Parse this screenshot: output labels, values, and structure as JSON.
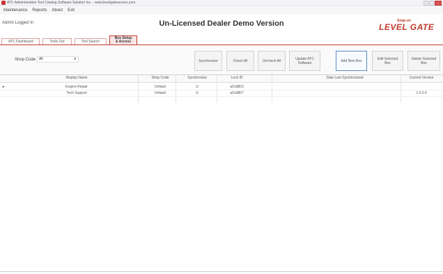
{
  "window": {
    "title": "ATC Administration Tool Catalog Software Solution Inc. - www.levelgateaccess.com"
  },
  "menu": [
    "Maintenance",
    "Reports",
    "About",
    "Exit"
  ],
  "header": {
    "login": "Admin Logged In",
    "title": "Un-Licensed Dealer Demo Version",
    "logo_tag": "Snap-on",
    "logo_mark": "LEVEL GATE"
  },
  "tabs": [
    "ATC Dashboard",
    "Tools Out",
    "Tool Search",
    "Box Setup & Access"
  ],
  "toolbar": {
    "shop_code_label": "Shop Code",
    "shop_code_value": "All",
    "synchronize": "Synchronize",
    "check_all": "Check All",
    "uncheck_all": "Uncheck All",
    "update_atc": "Update ATC Software",
    "add_new_box": "Add New Box",
    "edit_selected": "Edit Selected Box",
    "delete_selected": "Delete Selected Box"
  },
  "table": {
    "columns": [
      "Display Name",
      "Shop Code",
      "Synchronize",
      "Lock ID",
      "Date Last Synchronized",
      "Current Version"
    ],
    "rows": [
      {
        "marker": "▸",
        "display_name": "Engine Repair",
        "shop_code": "Default",
        "synchronize": "☑",
        "lock_id": "a01d803",
        "date_last_sync": "",
        "version": ""
      },
      {
        "marker": "",
        "display_name": "Tech Support",
        "shop_code": "Default",
        "synchronize": "☑",
        "lock_id": "a01d807",
        "date_last_sync": "",
        "version": "1.0.0.0"
      }
    ]
  },
  "colors": {
    "accent": "#c0392b",
    "highlight_border": "#5a8ac6"
  }
}
